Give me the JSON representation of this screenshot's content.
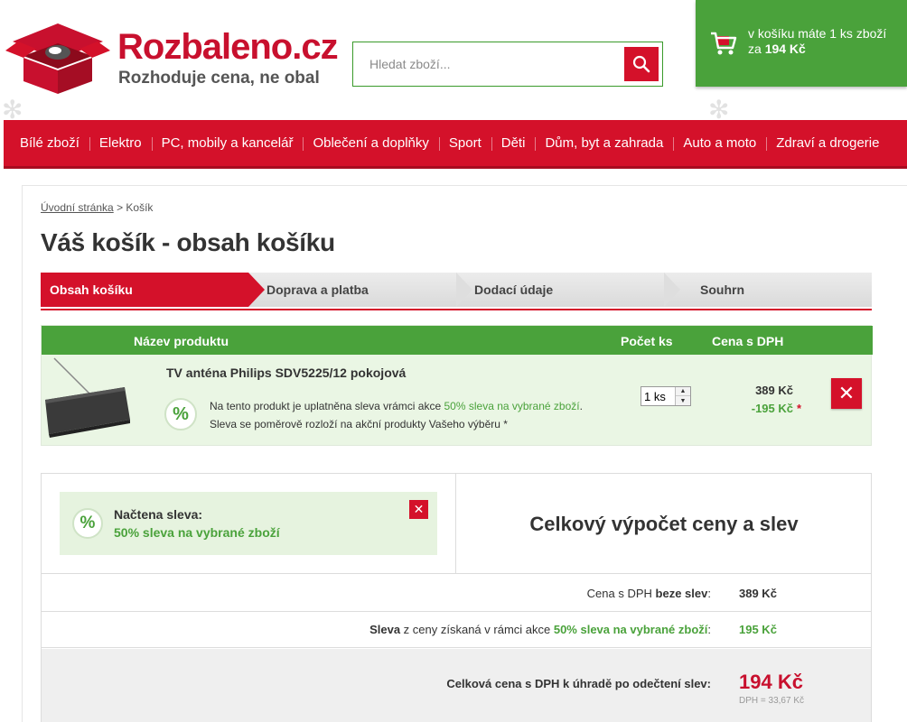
{
  "header": {
    "logo_text": "Rozbaleno.cz",
    "slogan": "Rozhoduje cena, ne obal",
    "search_placeholder": "Hledat zboží...",
    "cart_line1": "v košíku máte 1 ks zboží",
    "cart_line2_prefix": "za",
    "cart_total": "194 Kč"
  },
  "nav": {
    "items": [
      "Bílé zboží",
      "Elektro",
      "PC, mobily a kancelář",
      "Oblečení a doplňky",
      "Sport",
      "Děti",
      "Dům, byt a zahrada",
      "Auto a moto",
      "Zdraví a drogerie"
    ]
  },
  "breadcrumb": {
    "home": "Úvodní stránka",
    "separator": ">",
    "current": "Košík"
  },
  "page_title": "Váš košík - obsah košíku",
  "steps": [
    "Obsah košíku",
    "Doprava a platba",
    "Dodací údaje",
    "Souhrn"
  ],
  "table": {
    "col_name": "Název produktu",
    "col_qty": "Počet ks",
    "col_price": "Cena s DPH"
  },
  "item": {
    "name": "TV anténa Philips SDV5225/12 pokojová",
    "promo_text_1": "Na tento produkt je uplatněna sleva vrámci akce",
    "promo_name": "50% sleva na vybrané zboží",
    "promo_dot": ".",
    "promo_text_2": "Sleva se poměrově rozloží na akční produkty Vašeho výběru *",
    "quantity": "1 ks",
    "price": "389 Kč",
    "discount": "-195 Kč",
    "asterisk": "*",
    "badge": "%"
  },
  "coupon": {
    "title": "Načtena sleva:",
    "name": "50% sleva na vybrané zboží",
    "badge": "%"
  },
  "summary": {
    "title": "Celkový výpočet ceny a slev",
    "row1_label_plain": "Cena s DPH ",
    "row1_label_bold": "beze slev",
    "row1_label_colon": ":",
    "row1_value": "389 Kč",
    "row2_label_bold": "Sleva",
    "row2_label_plain": " z ceny získaná v rámci akce ",
    "row2_label_green": "50% sleva na vybrané zboží",
    "row2_label_colon": ":",
    "row2_value": "195 Kč",
    "total_label": "Celková cena s DPH k úhradě po odečtení slev:",
    "total_value": "194 Kč",
    "total_vat": "DPH = 33,67 Kč"
  },
  "colors": {
    "brand_red": "#d4112a",
    "brand_green": "#4aa23b"
  }
}
